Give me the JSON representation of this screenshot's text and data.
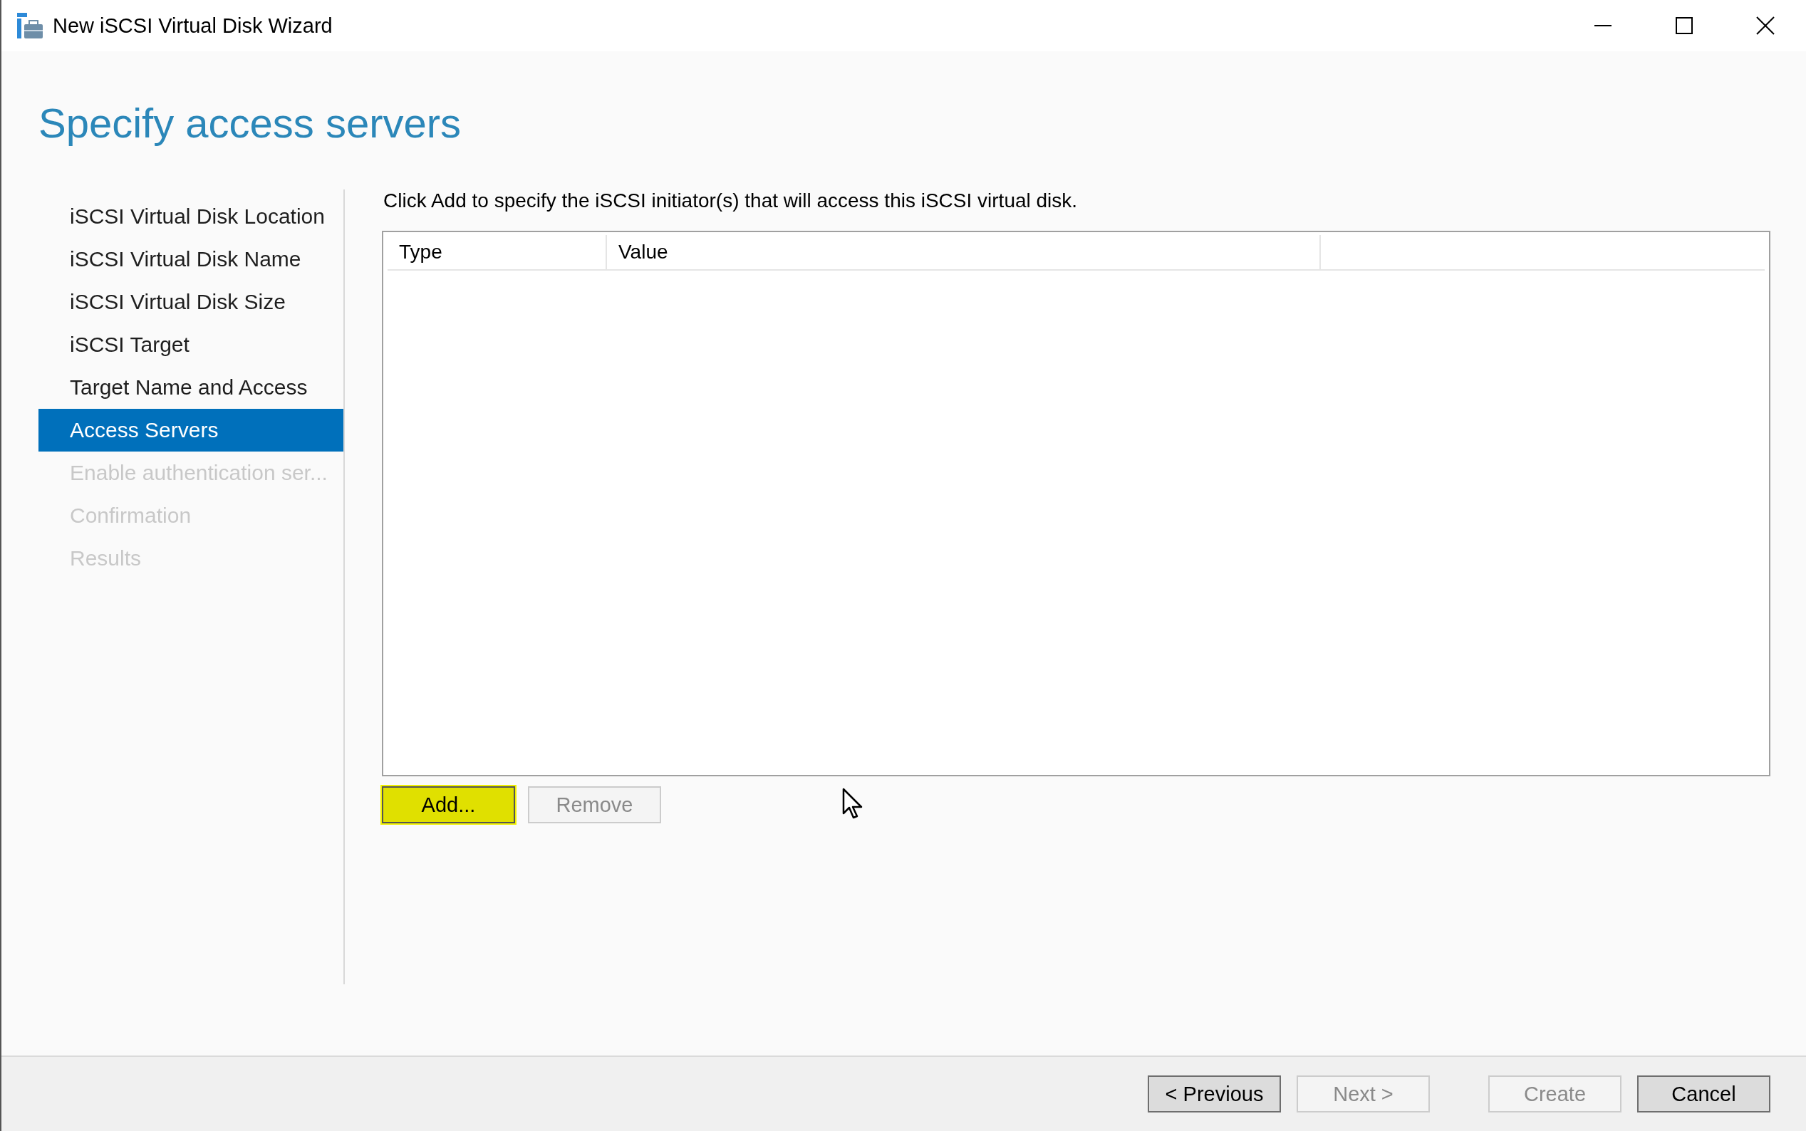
{
  "window": {
    "title": "New iSCSI Virtual Disk Wizard"
  },
  "page_title": "Specify access servers",
  "steps": [
    {
      "label": "iSCSI Virtual Disk Location",
      "selected": false,
      "disabled": false
    },
    {
      "label": "iSCSI Virtual Disk Name",
      "selected": false,
      "disabled": false
    },
    {
      "label": "iSCSI Virtual Disk Size",
      "selected": false,
      "disabled": false
    },
    {
      "label": "iSCSI Target",
      "selected": false,
      "disabled": false
    },
    {
      "label": "Target Name and Access",
      "selected": false,
      "disabled": false
    },
    {
      "label": "Access Servers",
      "selected": true,
      "disabled": false
    },
    {
      "label": "Enable authentication ser...",
      "selected": false,
      "disabled": true
    },
    {
      "label": "Confirmation",
      "selected": false,
      "disabled": true
    },
    {
      "label": "Results",
      "selected": false,
      "disabled": true
    }
  ],
  "instruction": "Click Add to specify the iSCSI initiator(s) that will access this iSCSI virtual disk.",
  "table": {
    "columns": [
      "Type",
      "Value"
    ]
  },
  "list_buttons": [
    {
      "label": "Add...",
      "disabled": false,
      "highlighted": true
    },
    {
      "label": "Remove",
      "disabled": true,
      "highlighted": false
    }
  ],
  "footer_buttons": [
    {
      "label": "< Previous",
      "disabled": false
    },
    {
      "label": "Next >",
      "disabled": true
    },
    {
      "label": "Create",
      "disabled": true
    },
    {
      "label": "Cancel",
      "disabled": false
    }
  ]
}
